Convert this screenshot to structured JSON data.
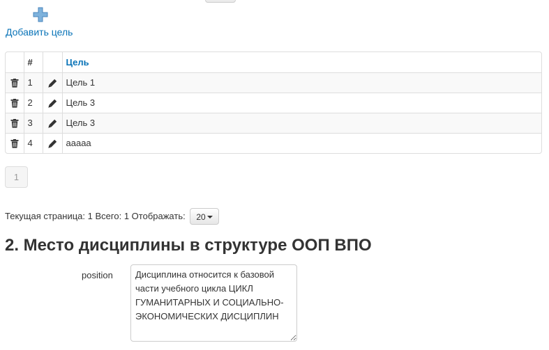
{
  "add_goal": {
    "label": "Добавить цель",
    "icon": "plus-icon"
  },
  "goals_table": {
    "columns": [
      "",
      "#",
      "",
      "Цель"
    ],
    "rows": [
      {
        "num": "1",
        "goal": "Цель 1"
      },
      {
        "num": "2",
        "goal": "Цель 3"
      },
      {
        "num": "3",
        "goal": "Цель 3"
      },
      {
        "num": "4",
        "goal": "aaaaa"
      }
    ],
    "row_icons": [
      "trash-icon",
      "pencil-icon"
    ]
  },
  "pagination": {
    "current_page": "1"
  },
  "page_info": {
    "current_label": "Текущая страница:",
    "current_value": "1",
    "total_label": "Всего:",
    "total_value": "1",
    "show_label": "Отображать:",
    "page_size": "20"
  },
  "section": {
    "title": "2. Место дисциплины в структуре ООП ВПО"
  },
  "position_field": {
    "label": "position",
    "value": "Дисциплина относится к базовой части учебного цикла ЦИКЛ ГУМАНИТАРНЫХ И СОЦИАЛЬНО-ЭКОНОМИЧЕСКИХ ДИСЦИПЛИН"
  },
  "colors": {
    "link": "#0a74b8",
    "text": "#333333",
    "border": "#dddddd",
    "stripe": "#f9f9f9",
    "plus_icon": "#7eb2dc"
  }
}
